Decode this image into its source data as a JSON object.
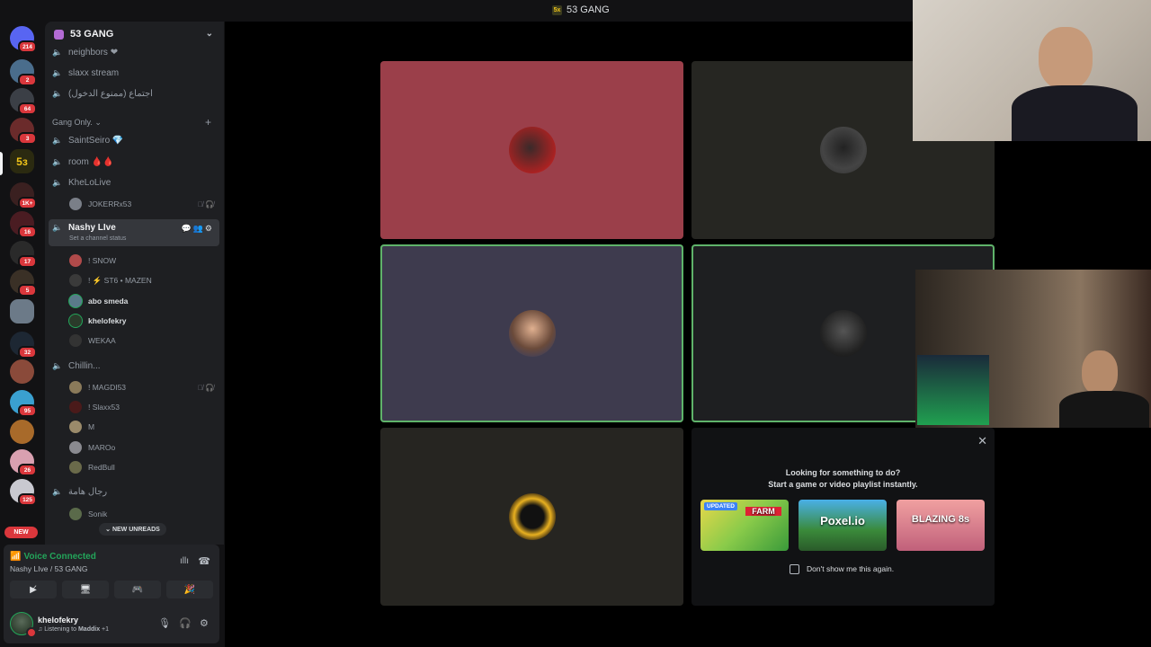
{
  "topbar": {
    "server_icon": "5x",
    "title": "53 GANG"
  },
  "servers": {
    "badges": [
      "214",
      "2",
      "64",
      "3",
      "1K+",
      "16",
      "17",
      "5",
      "32",
      "95",
      "26",
      "125"
    ],
    "new_label": "NEW"
  },
  "sidebar": {
    "guild_name": "53 GANG",
    "channels_top": [
      {
        "name": "neighbors ❤"
      },
      {
        "name": "slaxx stream"
      },
      {
        "name": "اجتماع (ممنوع الدخول)"
      }
    ],
    "category": "Gang Only.",
    "channels": [
      {
        "name": "SaintSeiro 💎"
      },
      {
        "name": "room 🩸🩸"
      },
      {
        "name": "KheLoLive"
      }
    ],
    "khelo_users": [
      {
        "name": "JOKERRx53"
      }
    ],
    "active_channel": {
      "name": "Nashy LIve",
      "status": "Set a channel status"
    },
    "nashy_users": [
      {
        "name": "! SNOW",
        "bright": false
      },
      {
        "name": "! ⚡ ST6 • MAZEN",
        "bright": false
      },
      {
        "name": "abo smeda",
        "bright": true
      },
      {
        "name": "khelofekry",
        "bright": true
      },
      {
        "name": "WEKAA",
        "bright": false
      }
    ],
    "chillin_channel": {
      "name": "Chillin..."
    },
    "chillin_users": [
      {
        "name": "! MAGDI53"
      },
      {
        "name": "! Slaxx53"
      },
      {
        "name": "M"
      },
      {
        "name": "MAROo"
      },
      {
        "name": "RedBull"
      }
    ],
    "men_channel": {
      "name": "رجال هامة"
    },
    "men_users": [
      {
        "name": "Sonik"
      }
    ],
    "new_unreads": "NEW UNREADS"
  },
  "voice": {
    "status": "Voice Connected",
    "channel": "Nashy LIve / 53 GANG"
  },
  "user": {
    "name": "khelofekry",
    "status_prefix": "Listening to",
    "status_app": "Maddix",
    "status_suffix": "+1"
  },
  "activity": {
    "title": "Looking for something to do?",
    "subtitle": "Start a game or video playlist instantly.",
    "cards": [
      {
        "title": "FARM",
        "tag": "UPDATED"
      },
      {
        "title": "Poxel.io",
        "tag": ""
      },
      {
        "title": "BLAZING 8s",
        "tag": ""
      }
    ],
    "dont_show": "Don't show me this again."
  },
  "colors": {
    "voice_green": "#23a55a",
    "badge_red": "#da373c",
    "speaking_border": "#5fb36a"
  }
}
